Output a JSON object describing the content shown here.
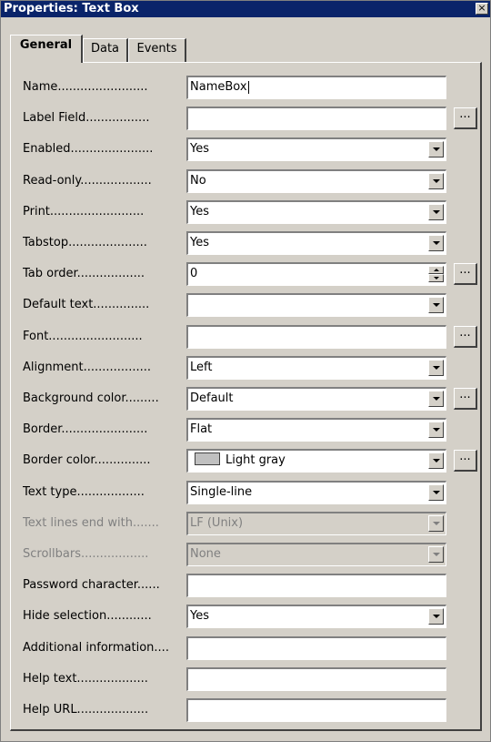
{
  "window": {
    "title": "Properties: Text Box",
    "close_glyph": "×"
  },
  "tabs": [
    {
      "label": "General",
      "active": true
    },
    {
      "label": "Data",
      "active": false
    },
    {
      "label": "Events",
      "active": false
    }
  ],
  "more_button_label": "...",
  "properties": [
    {
      "label": "Name........................",
      "value": "NameBox",
      "control": "text",
      "focused": true
    },
    {
      "label": "Label Field.................",
      "value": "",
      "control": "text",
      "has_more": true
    },
    {
      "label": "Enabled......................",
      "value": "Yes",
      "control": "select"
    },
    {
      "label": "Read-only...................",
      "value": "No",
      "control": "select"
    },
    {
      "label": "Print.........................",
      "value": "Yes",
      "control": "select"
    },
    {
      "label": "Tabstop.....................",
      "value": "Yes",
      "control": "select"
    },
    {
      "label": "Tab order..................",
      "value": "0",
      "control": "spin",
      "has_more": true
    },
    {
      "label": "Default text...............",
      "value": "",
      "control": "select"
    },
    {
      "label": "Font.........................",
      "value": "",
      "control": "text",
      "has_more": true
    },
    {
      "label": "Alignment..................",
      "value": "Left",
      "control": "select"
    },
    {
      "label": "Background color.........",
      "value": "Default",
      "control": "select",
      "has_more": true
    },
    {
      "label": "Border.......................",
      "value": "Flat",
      "control": "select"
    },
    {
      "label": "Border color...............",
      "value": "Light gray",
      "control": "color-select",
      "swatch_color": "#c0c0c0",
      "has_more": true
    },
    {
      "label": "Text type..................",
      "value": "Single-line",
      "control": "select"
    },
    {
      "label": "Text lines end with.......",
      "value": "LF (Unix)",
      "control": "select",
      "disabled": true
    },
    {
      "label": "Scrollbars..................",
      "value": "None",
      "control": "select",
      "disabled": true
    },
    {
      "label": "Password character......",
      "value": "",
      "control": "text"
    },
    {
      "label": "Hide selection............",
      "value": "Yes",
      "control": "select"
    },
    {
      "label": "Additional information....",
      "value": "",
      "control": "text"
    },
    {
      "label": "Help text...................",
      "value": "",
      "control": "text"
    },
    {
      "label": "Help URL...................",
      "value": "",
      "control": "text"
    }
  ],
  "colors": {
    "titlebar": "#0a246a",
    "dialog_face": "#d4d0c8",
    "disabled_text": "#808080"
  }
}
